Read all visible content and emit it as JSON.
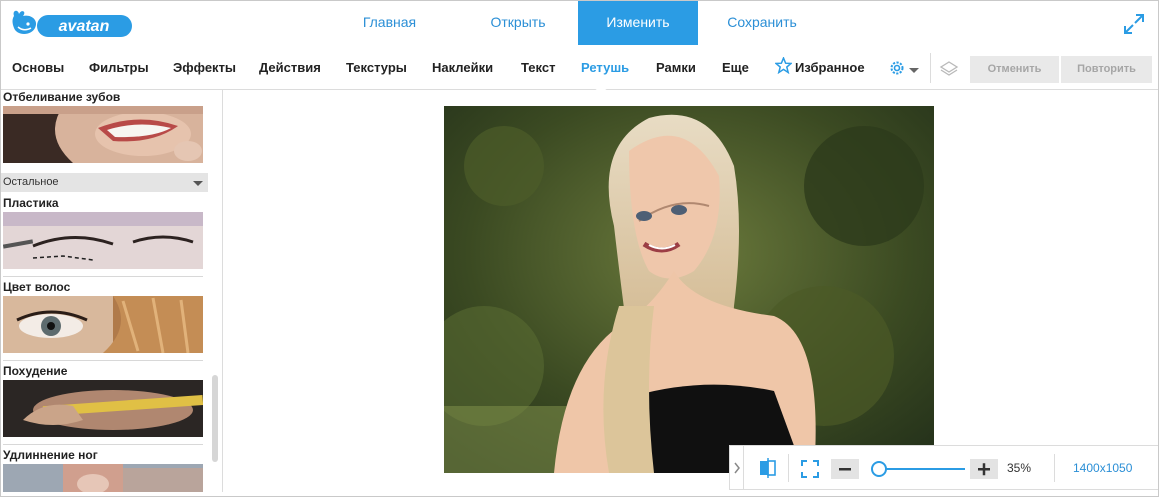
{
  "app": {
    "logo_text": "avatan",
    "colors": {
      "accent": "#2b9ce4",
      "link": "#2b8fd6",
      "text": "#222222",
      "disabled": "#a6a6a6"
    }
  },
  "header": {
    "nav": [
      {
        "label": "Главная"
      },
      {
        "label": "Открыть"
      },
      {
        "label": "Изменить",
        "active": true
      },
      {
        "label": "Сохранить"
      }
    ],
    "fullscreen_icon": "expand-arrows-icon"
  },
  "toolbar": {
    "tools": [
      "Основы",
      "Фильтры",
      "Эффекты",
      "Действия",
      "Текстуры",
      "Наклейки",
      "Текст",
      "Ретушь",
      "Рамки",
      "Еще"
    ],
    "active_tool": "Ретушь",
    "favorites_label": "Избранное",
    "settings_icon": "gear-icon",
    "layers_icon": "layers-icon",
    "undo_label": "Отменить",
    "redo_label": "Повторить"
  },
  "sidebar": {
    "top_item": "Отбеливание зубов",
    "dropdown_label": "Остальное",
    "items": [
      "Пластика",
      "Цвет волос",
      "Похудение",
      "Удлиннение ног"
    ]
  },
  "zoom": {
    "level_label": "35%",
    "image_size": "1400x1050",
    "level": 0.35
  }
}
